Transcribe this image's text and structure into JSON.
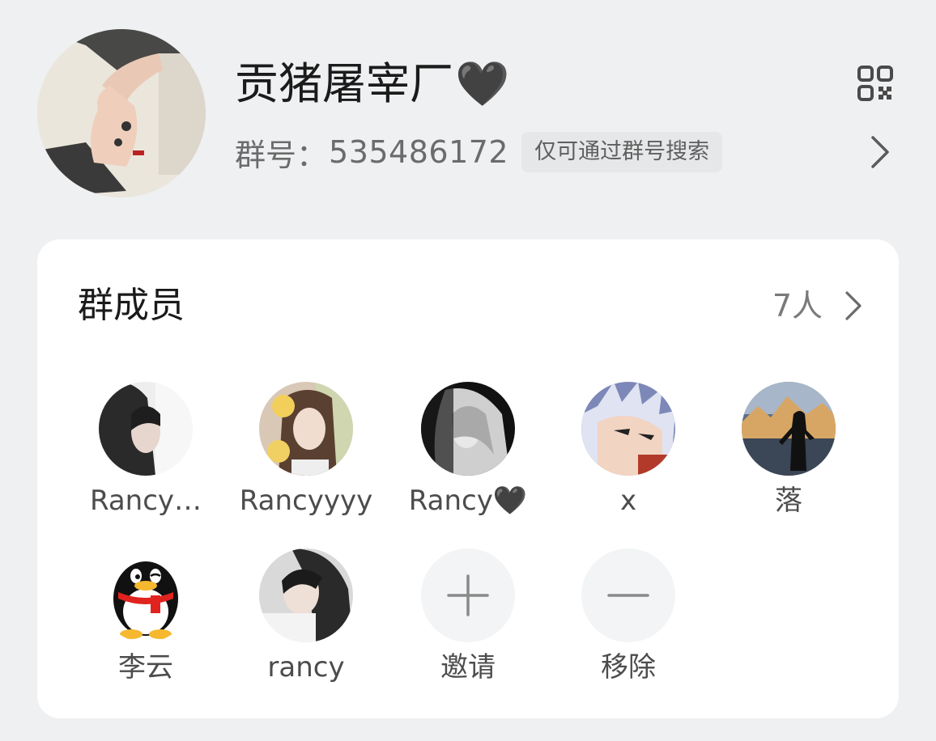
{
  "group": {
    "name": "贡猪屠宰厂",
    "name_suffix": "🖤",
    "id_label": "群号：",
    "id_value": "535486172",
    "search_hint": "仅可通过群号搜索"
  },
  "members_section": {
    "title": "群成员",
    "count": "7人"
  },
  "members": [
    {
      "name": "Rancy…",
      "avatar": "girl-portrait-avatar"
    },
    {
      "name": "Rancyyyy",
      "avatar": "girl-with-plush-avatar"
    },
    {
      "name": "Rancy🖤",
      "avatar": "monochrome-portrait-avatar"
    },
    {
      "name": "x",
      "avatar": "anime-character-avatar"
    },
    {
      "name": "落",
      "avatar": "mountain-silhouette-avatar"
    },
    {
      "name": "李云",
      "avatar": "qq-penguin-avatar"
    },
    {
      "name": "rancy",
      "avatar": "girl-portrait-avatar"
    }
  ],
  "actions": {
    "invite_label": "邀请",
    "remove_label": "移除"
  },
  "icons": {
    "qr": "qr-code-icon",
    "chevron": "chevron-right-icon",
    "plus": "plus-icon",
    "minus": "minus-icon"
  }
}
